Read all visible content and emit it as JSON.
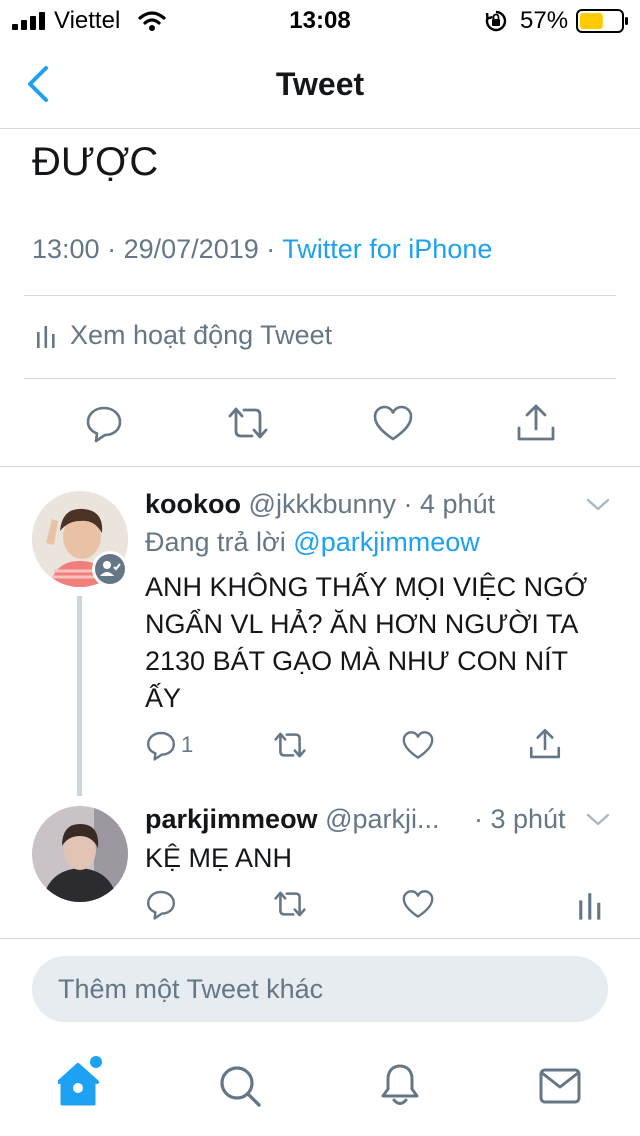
{
  "status_bar": {
    "carrier": "Viettel",
    "time": "13:08",
    "battery": "57%",
    "battery_level": 0.57
  },
  "nav": {
    "title": "Tweet"
  },
  "main_tweet": {
    "text": "ĐƯỢC",
    "time": "13:00",
    "date": "29/07/2019",
    "source": "Twitter for iPhone",
    "sep1": "·",
    "sep2": "·",
    "activity_label": "Xem hoạt động Tweet"
  },
  "replies": [
    {
      "name": "kookoo",
      "handle": "@jkkkbunny",
      "time": "· 4 phút",
      "replying_prefix": "Đang trả lời",
      "replying_to": "@parkjimmeow",
      "text_lines": [
        "ANH KHÔNG THẤY MỌI VIỆC NGỚ",
        "NGẨN VL HẢ? ĂN HƠN NGƯỜI TA",
        "2130 BÁT GẠO MÀ NHƯ CON NÍT",
        "ẤY"
      ],
      "reply_count": "1"
    },
    {
      "name": "parkjimmeow",
      "handle": "@parkji...",
      "time": "· 3 phút",
      "text": "KỆ MẸ ANH"
    }
  ],
  "compose": {
    "placeholder": "Thêm một Tweet khác"
  },
  "colors": {
    "accent": "#1da1f2",
    "secondary_text": "#657786",
    "divider": "#d5d9dc",
    "battery_fill": "#ffcc00"
  },
  "icons": {
    "back": "chevron-left-icon",
    "reply": "reply-icon",
    "retweet": "retweet-icon",
    "like": "heart-icon",
    "share": "share-icon",
    "analytics": "bar-chart-icon",
    "home": "home-icon",
    "search": "search-icon",
    "notifications": "bell-icon",
    "messages": "mail-icon"
  }
}
